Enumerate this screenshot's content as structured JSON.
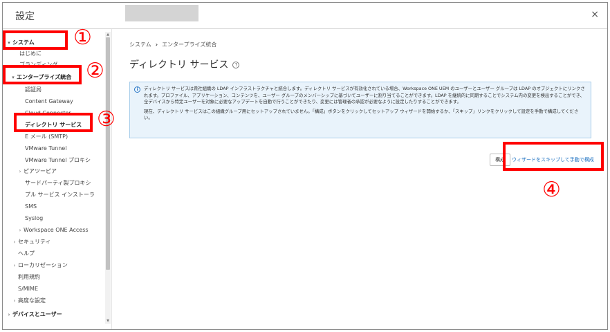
{
  "header": {
    "title": "設定",
    "close_glyph": "×"
  },
  "sidebar": {
    "items": [
      {
        "label": "システム",
        "chevron": "▾"
      },
      {
        "label": "はじめに",
        "chevron": ""
      },
      {
        "label": "ブランディング",
        "chevron": ""
      },
      {
        "label": "エンタープライズ統合",
        "chevron": "▾"
      },
      {
        "label": "認証局",
        "chevron": ""
      },
      {
        "label": "Content Gateway",
        "chevron": ""
      },
      {
        "label": "Cloud Connector",
        "chevron": ""
      },
      {
        "label": "ディレクトリ サービス",
        "chevron": ""
      },
      {
        "label": "E メール (SMTP)",
        "chevron": ""
      },
      {
        "label": "VMware Tunnel",
        "chevron": ""
      },
      {
        "label": "VMware Tunnel プロキシ",
        "chevron": ""
      },
      {
        "label": "ピアツーピア",
        "chevron": "›"
      },
      {
        "label": "サードパーティ製プロキシ",
        "chevron": ""
      },
      {
        "label": "プル サービス インストーラ",
        "chevron": ""
      },
      {
        "label": "SMS",
        "chevron": ""
      },
      {
        "label": "Syslog",
        "chevron": ""
      },
      {
        "label": "Workspace ONE Access",
        "chevron": "›"
      },
      {
        "label": "セキュリティ",
        "chevron": "›"
      },
      {
        "label": "ヘルプ",
        "chevron": ""
      },
      {
        "label": "ローカリゼーション",
        "chevron": "›"
      },
      {
        "label": "利用規約",
        "chevron": ""
      },
      {
        "label": "S/MIME",
        "chevron": ""
      },
      {
        "label": "高度な設定",
        "chevron": "›"
      },
      {
        "label": "デバイスとユーザー",
        "chevron": "›"
      }
    ]
  },
  "main": {
    "breadcrumb": {
      "root": "システム",
      "separator": "›",
      "current": "エンタープライズ統合"
    },
    "title": "ディレクトリ サービス",
    "help_glyph": "?",
    "info": {
      "icon_glyph": "i",
      "p1": "ディレクトリ サービスは貴社組織の LDAP インフラストラクチャと統合します。ディレクトリ サービスが有効化されている場合、Workspace ONE UEM のユーザーとユーザー グループは LDAP のオブジェクトにリンクされます。プロファイル、アプリケーション、コンテンツを、ユーザー グループのメンバーシップに基づいてユーザーに割り当てることができます。LDAP を継続的に同期することでシステム内の変更を検出することができ、全デバイスから特定ユーザーを対象に必要なアップデートを自動で行うことができたり、変更には管理者の承認が必要なように設定したりすることができます。",
      "p2": "現在、ディレクトリ サービスはこの組織グループ用にセットアップされていません。「構成」ボタンをクリックしてセットアップ ウィザードを開始するか、「スキップ」リンクをクリックして設定を手動で構成してください。"
    },
    "configure_label": "構成",
    "skip_link": "ウィザードをスキップして手動で構成"
  },
  "annotations": {
    "n1": "①",
    "n2": "②",
    "n3": "③",
    "n4": "④",
    "color": "#ff0000"
  }
}
